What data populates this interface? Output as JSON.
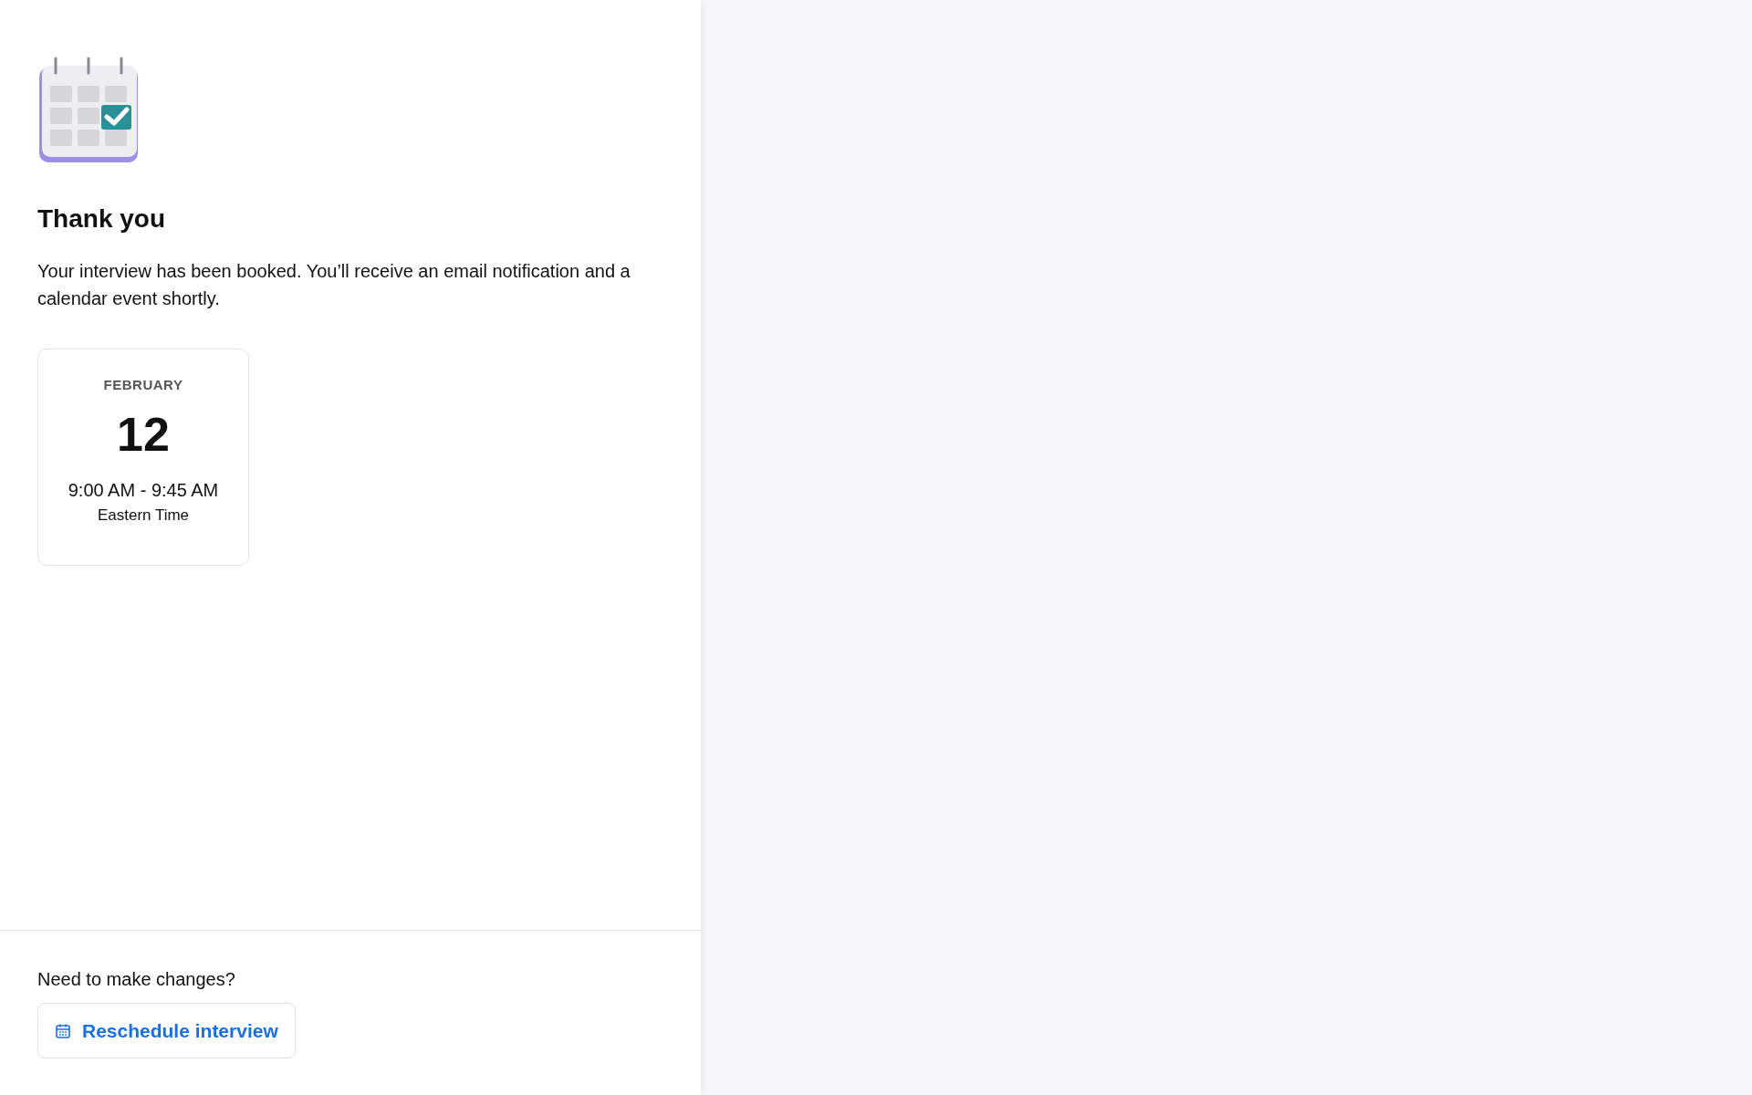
{
  "confirmation": {
    "title": "Thank you",
    "message": "Your interview has been booked. You’ll receive an email notification and a calendar event shortly."
  },
  "date_card": {
    "month": "FEBRUARY",
    "day": "12",
    "time": "9:00 AM - 9:45 AM",
    "timezone": "Eastern Time"
  },
  "footer": {
    "prompt": "Need to make changes?",
    "button": "Reschedule interview"
  }
}
